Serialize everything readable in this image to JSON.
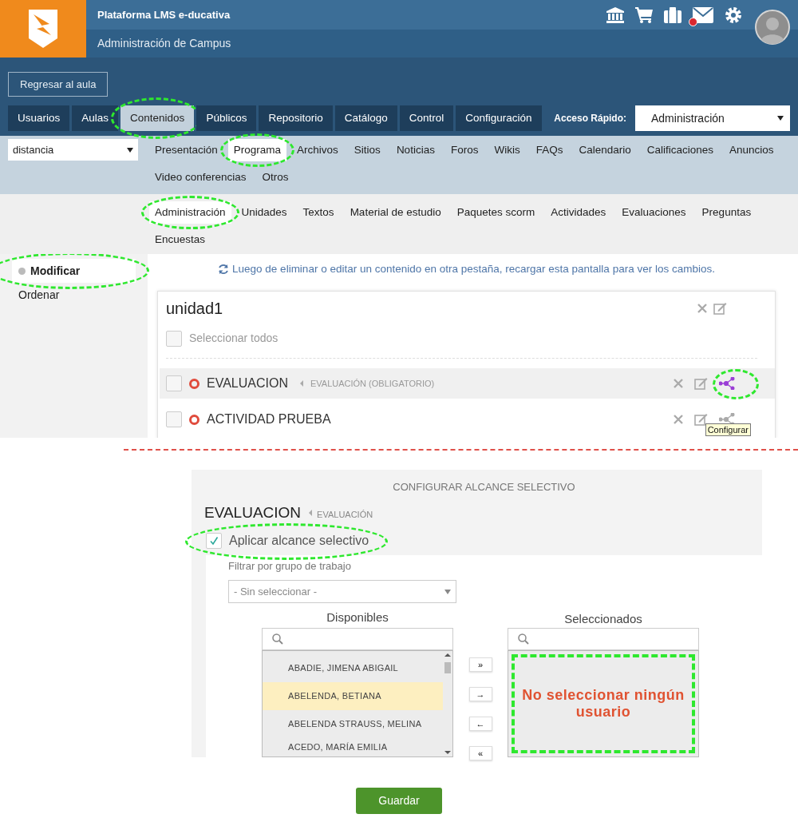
{
  "header": {
    "title": "Plataforma LMS e-ducativa",
    "subtitle": "Administración de Campus",
    "notification": true
  },
  "back_button": "Regresar al aula",
  "main_tabs": [
    {
      "label": "Usuarios",
      "selected": false,
      "circled": false
    },
    {
      "label": "Aulas",
      "selected": false,
      "circled": false
    },
    {
      "label": "Contenidos",
      "selected": true,
      "circled": true
    },
    {
      "label": "Públicos",
      "selected": false,
      "circled": false
    },
    {
      "label": "Repositorio",
      "selected": false,
      "circled": false
    },
    {
      "label": "Catálogo",
      "selected": false,
      "circled": false
    },
    {
      "label": "Control",
      "selected": false,
      "circled": false
    },
    {
      "label": "Configuración",
      "selected": false,
      "circled": false
    }
  ],
  "quick_access": {
    "label": "Acceso Rápido:",
    "value": "Administración"
  },
  "course_select": {
    "value": "distancia"
  },
  "course_menu": [
    {
      "label": "Presentación",
      "selected": false,
      "circled": false
    },
    {
      "label": "Programa",
      "selected": true,
      "circled": true
    },
    {
      "label": "Archivos",
      "selected": false,
      "circled": false
    },
    {
      "label": "Sitios",
      "selected": false,
      "circled": false
    },
    {
      "label": "Noticias",
      "selected": false,
      "circled": false
    },
    {
      "label": "Foros",
      "selected": false,
      "circled": false
    },
    {
      "label": "Wikis",
      "selected": false,
      "circled": false
    },
    {
      "label": "FAQs",
      "selected": false,
      "circled": false
    },
    {
      "label": "Calendario",
      "selected": false,
      "circled": false
    },
    {
      "label": "Calificaciones",
      "selected": false,
      "circled": false
    },
    {
      "label": "Anuncios",
      "selected": false,
      "circled": false
    },
    {
      "label": "Video conferencias",
      "selected": false,
      "circled": false
    },
    {
      "label": "Otros",
      "selected": false,
      "circled": false
    }
  ],
  "content_menu": [
    {
      "label": "Administración",
      "selected": true,
      "circled": true
    },
    {
      "label": "Unidades",
      "selected": false,
      "circled": false
    },
    {
      "label": "Textos",
      "selected": false,
      "circled": false
    },
    {
      "label": "Material de estudio",
      "selected": false,
      "circled": false
    },
    {
      "label": "Paquetes scorm",
      "selected": false,
      "circled": false
    },
    {
      "label": "Actividades",
      "selected": false,
      "circled": false
    },
    {
      "label": "Evaluaciones",
      "selected": false,
      "circled": false
    },
    {
      "label": "Preguntas",
      "selected": false,
      "circled": false
    },
    {
      "label": "Encuestas",
      "selected": false,
      "circled": false
    }
  ],
  "sidebar": [
    {
      "label": "Modificar",
      "selected": true,
      "circled": true
    },
    {
      "label": "Ordenar",
      "selected": false,
      "circled": false
    }
  ],
  "notice": "Luego de eliminar o editar un contenido en otra pestaña, recargar esta pantalla para ver los cambios.",
  "unit": {
    "title": "unidad1",
    "select_all": "Seleccionar todos",
    "select_all_checked": false,
    "items": [
      {
        "title": "EVALUACION",
        "type_label": "EVALUACIÓN (OBLIGATORIO)",
        "checked": false,
        "highlighted": true,
        "action_circled": true
      },
      {
        "title": "ACTIVIDAD PRUEBA",
        "checked": false,
        "highlighted": false,
        "action_circled": false,
        "tooltip": "Configurar"
      }
    ]
  },
  "dialog": {
    "heading": "CONFIGURAR ALCANCE SELECTIVO",
    "title": "EVALUACION",
    "type_label": "EVALUACIÓN",
    "apply": {
      "label": "Aplicar alcance selectivo",
      "checked": true,
      "circled": true
    },
    "filter_label": "Filtrar por grupo de trabajo",
    "filter_placeholder": "- Sin seleccionar -",
    "available": {
      "title": "Disponibles",
      "items": [
        {
          "name": "ABADIE, JIMENA ABIGAIL",
          "selected": false
        },
        {
          "name": "ABELENDA, BETIANA",
          "selected": true
        },
        {
          "name": "ABELENDA STRAUSS, MELINA",
          "selected": false
        },
        {
          "name": "ACEDO, MARÍA EMILIA",
          "selected": false
        }
      ]
    },
    "move_buttons": [
      "»",
      "→",
      "←",
      "«"
    ],
    "chosen": {
      "title": "Seleccionados",
      "note": "No seleccionar ningún usuario",
      "circled": true
    }
  },
  "save_button": "Guardar"
}
